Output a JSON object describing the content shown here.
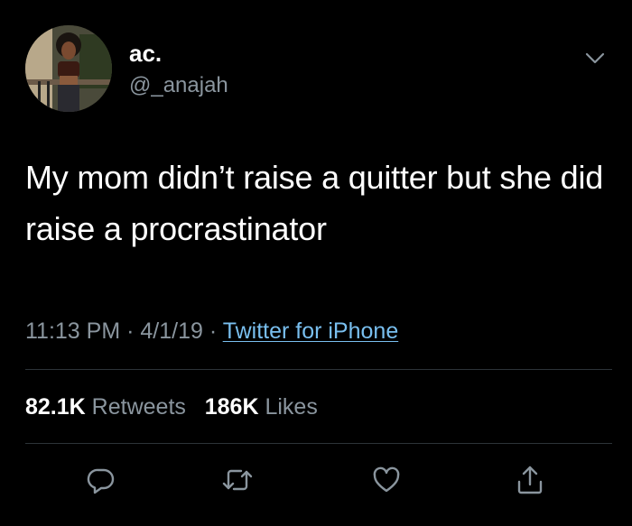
{
  "user": {
    "display_name": "ac.",
    "handle": "@_anajah"
  },
  "tweet": {
    "text": "My mom didn’t raise a quitter but she did raise a procrastinator",
    "time": "11:13 PM",
    "date": "4/1/19",
    "separator": "·",
    "source": "Twitter for iPhone"
  },
  "stats": {
    "retweets_count": "82.1K",
    "retweets_label": "Retweets",
    "likes_count": "186K",
    "likes_label": "Likes"
  },
  "icons": {
    "more": "chevron-down-icon",
    "reply": "reply-icon",
    "retweet": "retweet-icon",
    "like": "like-icon",
    "share": "share-icon"
  },
  "colors": {
    "background": "#000000",
    "text": "#ffffff",
    "muted": "#8a959e",
    "link": "#79bfef",
    "divider": "#2c3338"
  }
}
